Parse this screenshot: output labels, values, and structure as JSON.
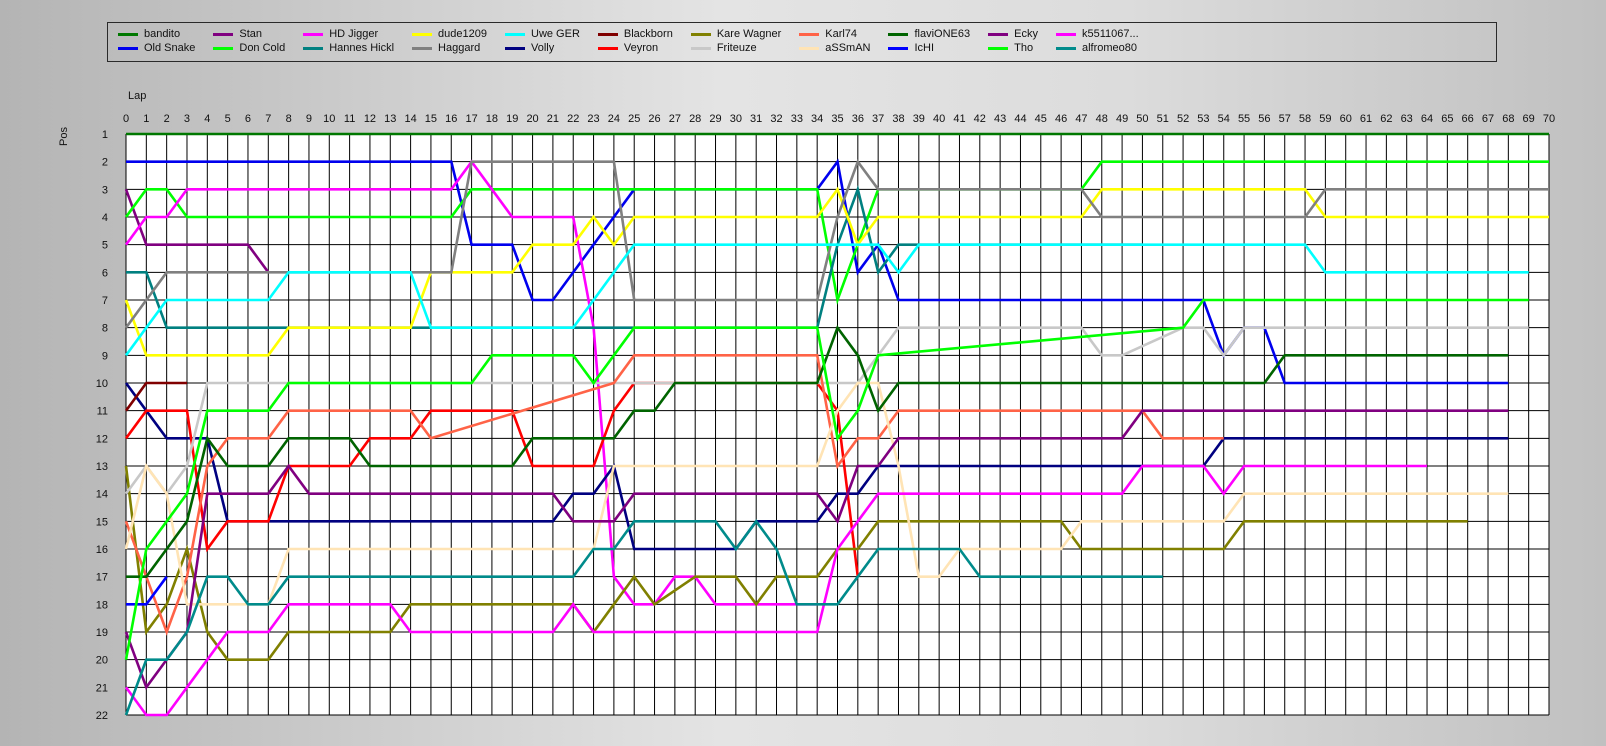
{
  "chart_data": {
    "type": "line",
    "title": "",
    "xlabel": "Lap",
    "ylabel": "Pos",
    "xlim": [
      0,
      70
    ],
    "ylim": [
      1,
      22
    ],
    "y_inverted": true,
    "grid": true,
    "legend_position": "top",
    "x_ticks": [
      "0",
      "1",
      "2",
      "3",
      "4",
      "5",
      "6",
      "7",
      "8",
      "9",
      "10",
      "11",
      "12",
      "13",
      "14",
      "15",
      "16",
      "17",
      "18",
      "19",
      "20",
      "21",
      "22",
      "23",
      "24",
      "25",
      "26",
      "27",
      "28",
      "29",
      "30",
      "31",
      "32",
      "33",
      "34",
      "35",
      "36",
      "37",
      "38",
      "39",
      "40",
      "41",
      "42",
      "43",
      "44",
      "45",
      "46",
      "47",
      "48",
      "49",
      "50",
      "51",
      "52",
      "53",
      "54",
      "55",
      "56",
      "57",
      "58",
      "59",
      "60",
      "61",
      "62",
      "63",
      "64",
      "65",
      "66",
      "67",
      "68",
      "69",
      "70"
    ],
    "y_ticks": [
      "1",
      "2",
      "3",
      "4",
      "5",
      "6",
      "7",
      "8",
      "9",
      "10",
      "11",
      "12",
      "13",
      "14",
      "15",
      "16",
      "17",
      "18",
      "19",
      "20",
      "21",
      "22"
    ],
    "series": [
      {
        "name": "bandito",
        "color": "#007800",
        "x": [
          0,
          70
        ],
        "y": [
          1,
          1
        ]
      },
      {
        "name": "Old Snake",
        "color": "#0000ee",
        "x": [
          0,
          16,
          17,
          19,
          20,
          21,
          25,
          34,
          35,
          36,
          37,
          38,
          53,
          54,
          55,
          56,
          57,
          68
        ],
        "y": [
          2,
          2,
          5,
          5,
          7,
          7,
          3,
          3,
          2,
          6,
          5,
          7,
          7,
          9,
          8,
          8,
          10,
          10
        ]
      },
      {
        "name": "Stan",
        "color": "#800080",
        "x": [
          0,
          1,
          6,
          7
        ],
        "y": [
          3,
          5,
          5,
          6
        ]
      },
      {
        "name": "Don Cold",
        "color": "#00ff00",
        "x": [
          0,
          1,
          2,
          3,
          4,
          16,
          17,
          18,
          19,
          34,
          35,
          36,
          37,
          47,
          48,
          70
        ],
        "y": [
          4,
          3,
          3,
          4,
          4,
          4,
          3,
          3,
          3,
          3,
          7,
          5,
          3,
          3,
          2,
          2
        ]
      },
      {
        "name": "HD Jigger",
        "color": "#ff00ff",
        "x": [
          0,
          1,
          2,
          3,
          16,
          17,
          18,
          19,
          22,
          23,
          24,
          25,
          26,
          27,
          28,
          29,
          30,
          34
        ],
        "y": [
          5,
          4,
          4,
          3,
          3,
          2,
          3,
          4,
          4,
          8,
          17,
          18,
          18,
          17,
          17,
          18,
          18,
          18
        ]
      },
      {
        "name": "Hannes Hickl",
        "color": "#008080",
        "x": [
          0,
          1,
          2,
          3,
          34,
          35,
          36,
          37,
          38,
          39,
          50
        ],
        "y": [
          6,
          6,
          8,
          8,
          8,
          5,
          3,
          6,
          5,
          5,
          5
        ]
      },
      {
        "name": "dude1209",
        "color": "#ffff00",
        "x": [
          0,
          1,
          7,
          8,
          14,
          15,
          19,
          20,
          22,
          23,
          24,
          25,
          34,
          35,
          36,
          37,
          47,
          48,
          58,
          59,
          70
        ],
        "y": [
          7,
          9,
          9,
          8,
          8,
          6,
          6,
          5,
          5,
          4,
          5,
          4,
          4,
          3,
          5,
          4,
          4,
          3,
          3,
          4,
          4
        ]
      },
      {
        "name": "Haggard",
        "color": "#808080",
        "x": [
          0,
          1,
          2,
          3,
          16,
          17,
          18,
          24,
          25,
          34,
          35,
          36,
          37,
          47,
          48,
          58,
          59,
          70
        ],
        "y": [
          8,
          7,
          6,
          6,
          6,
          2,
          2,
          2,
          7,
          7,
          4,
          2,
          3,
          3,
          4,
          4,
          3,
          3
        ]
      },
      {
        "name": "Uwe GER",
        "color": "#00ffff",
        "x": [
          0,
          1,
          2,
          7,
          8,
          14,
          15,
          22,
          23,
          24,
          25,
          37,
          38,
          39,
          51,
          52,
          58,
          59,
          69
        ],
        "y": [
          9,
          8,
          7,
          7,
          6,
          6,
          8,
          8,
          7,
          6,
          5,
          5,
          6,
          5,
          5,
          5,
          5,
          6,
          6
        ]
      },
      {
        "name": "Volly",
        "color": "#000080",
        "x": [
          0,
          1,
          2,
          3,
          4,
          5,
          7,
          8,
          21,
          22,
          23,
          24,
          25,
          30,
          31,
          33,
          34,
          35,
          36,
          37,
          38,
          53,
          54,
          68
        ],
        "y": [
          10,
          11,
          12,
          12,
          12,
          15,
          15,
          15,
          15,
          14,
          14,
          13,
          16,
          16,
          15,
          15,
          15,
          14,
          14,
          13,
          13,
          13,
          12,
          12
        ]
      },
      {
        "name": "Blackborn",
        "color": "#800000",
        "x": [
          0,
          1,
          3
        ],
        "y": [
          11,
          10,
          10
        ]
      },
      {
        "name": "Veyron",
        "color": "#ff0000",
        "x": [
          0,
          1,
          3,
          4,
          5,
          7,
          8,
          11,
          12,
          14,
          15,
          19,
          20,
          23,
          24,
          25,
          34,
          35,
          36
        ],
        "y": [
          12,
          11,
          11,
          16,
          15,
          15,
          13,
          13,
          12,
          12,
          11,
          11,
          13,
          13,
          11,
          10,
          10,
          11,
          17
        ]
      },
      {
        "name": "Kare Wagner",
        "color": "#808000",
        "x": [
          0,
          1,
          2,
          3,
          4,
          5,
          7,
          8,
          13,
          14,
          22,
          23,
          24,
          25,
          26,
          28,
          30,
          31,
          32,
          34,
          35,
          36,
          37,
          38,
          46,
          47,
          54,
          55,
          66
        ],
        "y": [
          13,
          19,
          18,
          16,
          19,
          20,
          20,
          19,
          19,
          18,
          18,
          19,
          18,
          17,
          18,
          17,
          17,
          18,
          17,
          17,
          16,
          16,
          15,
          15,
          15,
          16,
          16,
          15,
          15
        ]
      },
      {
        "name": "Friteuze",
        "color": "#c8c8c8",
        "x": [
          0,
          1,
          2,
          3,
          4,
          36,
          37,
          38,
          46,
          47,
          48,
          49,
          52,
          53,
          54,
          55,
          56,
          57,
          69
        ],
        "y": [
          14,
          13,
          14,
          13,
          10,
          10,
          9,
          8,
          8,
          8,
          9,
          9,
          8,
          8,
          9,
          8,
          8,
          8,
          8
        ]
      },
      {
        "name": "Karl74",
        "color": "#ff6347",
        "x": [
          0,
          1,
          2,
          3,
          4,
          5,
          7,
          8,
          14,
          15,
          24,
          25,
          34,
          35,
          36,
          37,
          38,
          50,
          51,
          54
        ],
        "y": [
          15,
          17,
          19,
          17,
          13,
          12,
          12,
          11,
          11,
          12,
          10,
          9,
          9,
          13,
          12,
          12,
          11,
          11,
          12,
          12
        ]
      },
      {
        "name": "aSSmAN",
        "color": "#ffe4b5",
        "x": [
          0,
          1,
          2,
          3,
          7,
          8,
          23,
          24,
          34,
          35,
          36,
          37,
          38,
          39,
          40,
          41,
          42,
          46,
          47,
          54,
          55,
          68
        ],
        "y": [
          16,
          13,
          14,
          18,
          18,
          16,
          16,
          13,
          13,
          11,
          10,
          10,
          13,
          17,
          17,
          16,
          16,
          16,
          15,
          15,
          14,
          14
        ]
      },
      {
        "name": "flaviONE63",
        "color": "#006400",
        "x": [
          0,
          1,
          2,
          3,
          4,
          5,
          7,
          8,
          11,
          12,
          19,
          20,
          24,
          25,
          26,
          27,
          34,
          35,
          36,
          37,
          38,
          56,
          57,
          68
        ],
        "y": [
          17,
          17,
          16,
          15,
          12,
          13,
          13,
          12,
          12,
          13,
          13,
          12,
          12,
          11,
          11,
          10,
          10,
          8,
          9,
          11,
          10,
          10,
          9,
          9
        ]
      },
      {
        "name": "IcHI",
        "color": "#0000ff",
        "x": [
          0,
          1,
          2
        ],
        "y": [
          18,
          18,
          17
        ]
      },
      {
        "name": "Ecky",
        "color": "#800080",
        "x": [
          0,
          1,
          3,
          4,
          7,
          8,
          9,
          21,
          22,
          24,
          25,
          34,
          35,
          36,
          37,
          38,
          49,
          50,
          68
        ],
        "y": [
          19,
          21,
          19,
          14,
          14,
          13,
          14,
          14,
          15,
          15,
          14,
          14,
          15,
          13,
          13,
          12,
          12,
          11,
          11
        ]
      },
      {
        "name": "Tho",
        "color": "#00ff00",
        "x": [
          0,
          1,
          2,
          3,
          4,
          7,
          8,
          17,
          18,
          22,
          23,
          24,
          25,
          34,
          35,
          36,
          37,
          52,
          53,
          69
        ],
        "y": [
          20,
          16,
          15,
          14,
          11,
          11,
          10,
          10,
          9,
          9,
          10,
          9,
          8,
          8,
          12,
          11,
          9,
          8,
          7,
          7
        ]
      },
      {
        "name": "k5511067...",
        "color": "#ff00ff",
        "x": [
          0,
          1,
          2,
          3,
          4,
          5,
          7,
          8,
          13,
          14,
          21,
          22,
          23,
          34,
          35,
          36,
          37,
          38,
          49,
          50,
          52,
          53,
          54,
          55,
          64
        ],
        "y": [
          21,
          22,
          22,
          21,
          20,
          19,
          19,
          18,
          18,
          19,
          19,
          18,
          19,
          19,
          16,
          15,
          14,
          14,
          14,
          13,
          13,
          13,
          14,
          13,
          13
        ]
      },
      {
        "name": "alfromeo80",
        "color": "#008b8b",
        "x": [
          0,
          1,
          2,
          3,
          4,
          5,
          6,
          7,
          8,
          22,
          23,
          24,
          25,
          29,
          30,
          31,
          32,
          33,
          34,
          35,
          36,
          37,
          38,
          41,
          42,
          51
        ],
        "y": [
          22,
          20,
          20,
          19,
          17,
          17,
          18,
          18,
          17,
          17,
          16,
          16,
          15,
          15,
          16,
          15,
          16,
          18,
          18,
          18,
          17,
          16,
          16,
          16,
          17,
          17
        ]
      }
    ]
  }
}
